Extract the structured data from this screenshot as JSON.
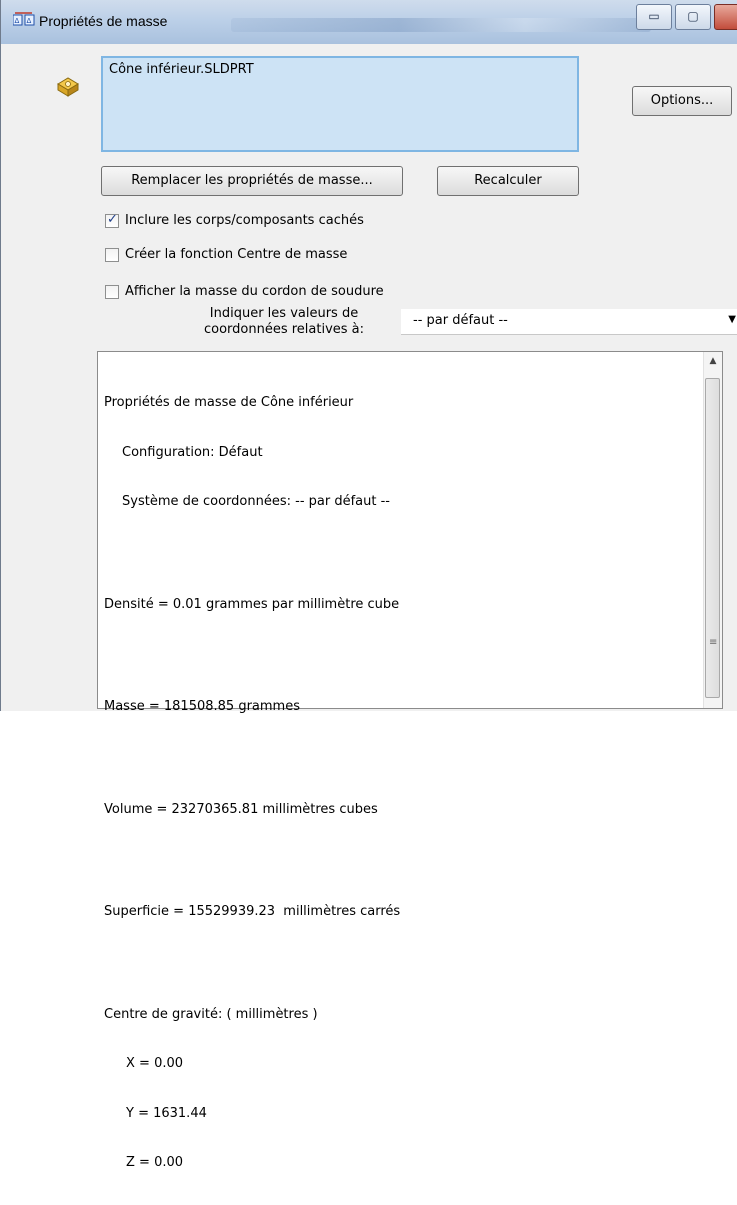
{
  "window": {
    "title": "Propriétés de masse",
    "minimize_glyph": "▭",
    "maximize_glyph": "▢"
  },
  "file_box": {
    "value": "Cône inférieur.SLDPRT"
  },
  "buttons": {
    "options": "Options...",
    "replace": "Remplacer les propriétés de masse...",
    "recalculate": "Recalculer"
  },
  "checkboxes": [
    {
      "label": "Inclure les corps/composants cachés",
      "checked": true
    },
    {
      "label": "Créer la fonction Centre de masse",
      "checked": false
    },
    {
      "label": "Afficher la masse du cordon de soudure",
      "checked": false
    }
  ],
  "coords": {
    "label_line1": "Indiquer les valeurs de",
    "label_line2": "coordonnées relatives à:",
    "selected": "-- par défaut --"
  },
  "results": {
    "heading": "Propriétés de masse de Cône inférieur",
    "configuration": "Configuration: Défaut",
    "coordinate_system": "Système de coordonnées: -- par défaut --",
    "density": "Densité = 0.01 grammes par millimètre cube",
    "mass": "Masse = 181508.85 grammes",
    "volume": "Volume = 23270365.81 millimètres cubes",
    "surface": "Superficie = 15529939.23  millimètres carrés",
    "cog_heading": "Centre de gravité: ( millimètres )",
    "cog_x": "X = 0.00",
    "cog_y": "Y = 1631.44",
    "cog_z": "Z = 0.00"
  },
  "colors": {
    "file_box_bg": "#cde3f5",
    "file_box_border": "#7fb6e3",
    "titlebar": "#bcd0e8"
  }
}
